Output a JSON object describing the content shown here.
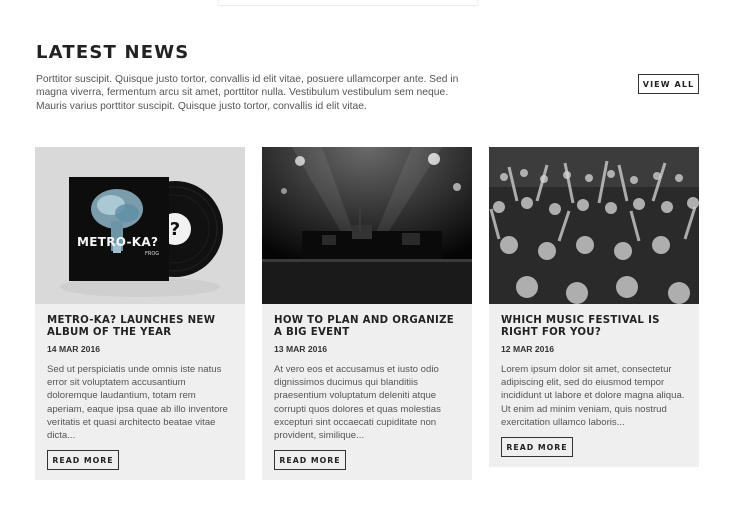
{
  "section": {
    "heading": "LATEST NEWS",
    "intro": "Porttitor suscipit. Quisque justo tortor, convallis id elit vitae, posuere ullamcorper ante. Sed in magna viverra, fermentum arcu sit amet, porttitor nulla. Vestibulum vestibulum sem neque. Mauris varius porttitor suscipit. Quisque justo tortor, convallis id elit vitae.",
    "view_all_label": "VIEW ALL"
  },
  "cards": [
    {
      "title": "METRO-KA? LAUNCHES NEW ALBUM OF THE YEAR",
      "date": "14 MAR 2016",
      "excerpt": "Sed ut perspiciatis unde omnis iste natus error sit voluptatem accusantium doloremque laudantium, totam rem aperiam, eaque ipsa quae ab illo inventore veritatis et quasi architecto beatae vitae dicta...",
      "button": "READ MORE",
      "album_text": "METRO-KA?",
      "album_subtext": "FROG",
      "image_icon": "vinyl-record-icon"
    },
    {
      "title": "HOW TO PLAN AND ORGANIZE A BIG EVENT",
      "date": "13 MAR 2016",
      "excerpt": "At vero eos et accusamus et iusto odio dignissimos ducimus qui blanditiis praesentium voluptatum deleniti atque corrupti quos dolores et quas molestias excepturi sint occaecati cupiditate non provident, similique...",
      "button": "READ MORE",
      "image_icon": "concert-stage-icon"
    },
    {
      "title": "WHICH MUSIC FESTIVAL IS RIGHT FOR YOU?",
      "date": "12 MAR 2016",
      "excerpt": "Lorem ipsum dolor sit amet, consectetur adipiscing elit, sed do eiusmod tempor incididunt ut labore et dolore magna aliqua. Ut enim ad minim veniam, quis nostrud exercitation ullamco laboris...",
      "button": "READ MORE",
      "image_icon": "crowd-icon"
    }
  ],
  "colors": {
    "card_bg": "#efefef",
    "heading": "#222222",
    "text": "#555555"
  }
}
